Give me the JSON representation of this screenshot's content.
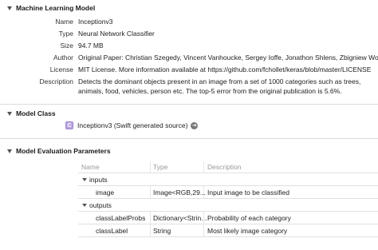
{
  "sections": {
    "model": {
      "title": "Machine Learning Model",
      "rows": [
        {
          "label": "Name",
          "value": "Inceptionv3"
        },
        {
          "label": "Type",
          "value": "Neural Network Classifier"
        },
        {
          "label": "Size",
          "value": "94.7 MB"
        },
        {
          "label": "Author",
          "value": "Original Paper: Christian Szegedy, Vincent Vanhoucke, Sergey Ioffe, Jonathon Shlens, Zbigniew Wojna. Ker"
        },
        {
          "label": "License",
          "value": "MIT License. More information available at https://github.com/fchollet/keras/blob/master/LICENSE"
        },
        {
          "label": "Description",
          "value": "Detects the dominant objects present in an image from a set of 1000 categories such as trees, animals, food, vehicles, person etc. The top-5 error from the original publication is 5.6%."
        }
      ]
    },
    "model_class": {
      "title": "Model Class",
      "icon_letter": "C",
      "class_text": "Inceptionv3 (Swift generated source)",
      "arrow_glyph": "➔"
    },
    "evaluation": {
      "title": "Model Evaluation Parameters",
      "columns": {
        "name": "Name",
        "type": "Type",
        "description": "Description"
      },
      "inputs_label": "inputs",
      "outputs_label": "outputs",
      "inputs": [
        {
          "name": "image",
          "type": "Image<RGB,29...",
          "description": "Input image to be classified"
        }
      ],
      "outputs": [
        {
          "name": "classLabelProbs",
          "type": "Dictionary<Strin...",
          "description": "Probability of each category"
        },
        {
          "name": "classLabel",
          "type": "String",
          "description": "Most likely image category"
        }
      ]
    }
  },
  "colors": {
    "class_icon": "#b9a6e0",
    "divider": "#dcdcdc",
    "header_text": "#999999"
  },
  "icons": {
    "disclosure": "disclosure-triangle-icon",
    "class": "swift-class-icon",
    "go": "go-arrow-icon"
  }
}
